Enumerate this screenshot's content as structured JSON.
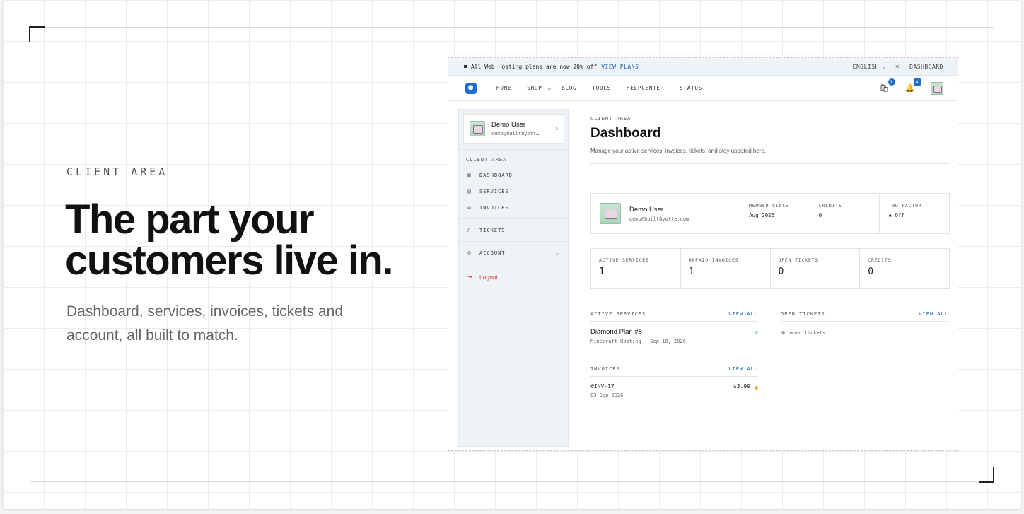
{
  "hero": {
    "eyebrow": "CLIENT AREA",
    "headline": "The part your customers live in.",
    "subtext": "Dashboard, services, invoices, tickets and account, all built to match."
  },
  "announcement": {
    "text": "All Web Hosting plans are now 20% off",
    "link": "VIEW PLANS",
    "language": "ENGLISH",
    "dashboard": "DASHBOARD"
  },
  "nav": {
    "items": [
      "HOME",
      "SHOP",
      "BLOG",
      "TOOLS",
      "HELPCENTER",
      "STATUS"
    ],
    "cart_count": "1",
    "notification_count": "4"
  },
  "sidebar": {
    "user_name": "Demo User",
    "user_email": "demo@builtbyott…",
    "section_label": "CLIENT AREA",
    "items": {
      "dashboard": "DASHBOARD",
      "services": "SERVICES",
      "invoices": "INVOICES",
      "tickets": "TICKETS",
      "account": "ACCOUNT",
      "logout": "Logout"
    }
  },
  "main": {
    "crumb": "CLIENT AREA",
    "title": "Dashboard",
    "description": "Manage your active services, invoices, tickets, and stay updated here.",
    "profile": {
      "name": "Demo User",
      "email": "demo@builtbyotte.com",
      "member_since_label": "MEMBER SINCE",
      "member_since": "Aug 2026",
      "credits_label": "CREDITS",
      "credits": "0",
      "two_factor_label": "TWO-FACTOR",
      "two_factor": "Off"
    },
    "stats": [
      {
        "label": "ACTIVE SERVICES",
        "value": "1"
      },
      {
        "label": "UNPAID INVOICES",
        "value": "1"
      },
      {
        "label": "OPEN TICKETS",
        "value": "0"
      },
      {
        "label": "CREDITS",
        "value": "0"
      }
    ],
    "active_services": {
      "label": "ACTIVE SERVICES",
      "view_all": "VIEW ALL",
      "name": "Diamond Plan #8",
      "meta": "Minecraft Hosting · Sep 18, 2026",
      "status_color": "#b9ddc8"
    },
    "open_tickets": {
      "label": "OPEN TICKETS",
      "view_all": "VIEW ALL",
      "empty": "No open tickets"
    },
    "invoices": {
      "label": "INVOICES",
      "view_all": "VIEW ALL",
      "number": "#INV-17",
      "date": "03 Sep 2026",
      "amount": "$3.99",
      "status_color": "#f0a73a"
    }
  },
  "colors": {
    "accent": "#1b6fd1",
    "link": "#1f5fa8",
    "danger": "#d23a3a"
  }
}
